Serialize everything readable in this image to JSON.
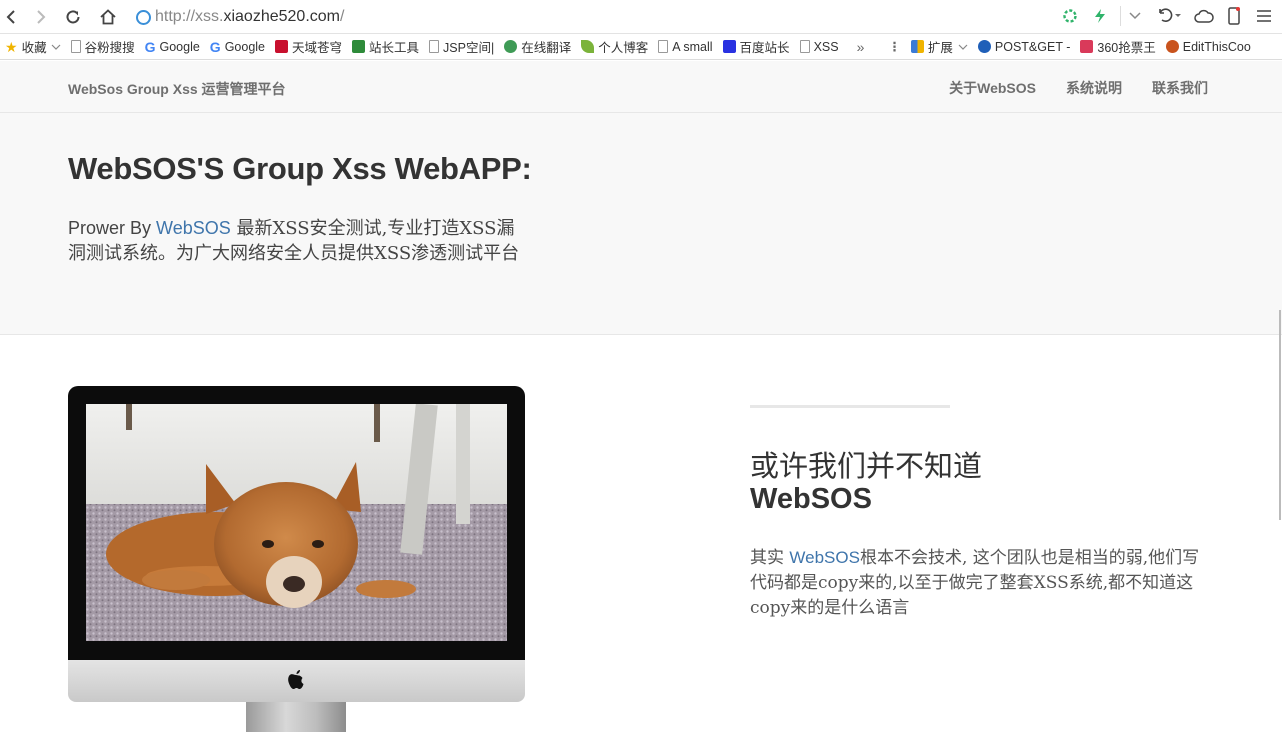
{
  "browser": {
    "url_prefix": "http://xss.",
    "url_domain": "xiaozhe520.com",
    "url_suffix": "/",
    "bookmarks": [
      {
        "label": "收藏",
        "icon": "star-icon"
      },
      {
        "label": "谷粉搜搜",
        "icon": "page-icon"
      },
      {
        "label": "Google",
        "icon": "google-icon"
      },
      {
        "label": "Google",
        "icon": "google-icon"
      },
      {
        "label": "天域苍穹",
        "icon": "site-icon",
        "color": "#c8102e"
      },
      {
        "label": "站长工具",
        "icon": "site-icon",
        "color": "#2e8b3a"
      },
      {
        "label": "JSP空间|",
        "icon": "page-icon"
      },
      {
        "label": "在线翻译",
        "icon": "translate-icon",
        "color": "#3f9b56"
      },
      {
        "label": "个人博客",
        "icon": "leaf-icon",
        "color": "#7bb33a"
      },
      {
        "label": "A small",
        "icon": "page-icon"
      },
      {
        "label": "百度站长",
        "icon": "baidu-icon",
        "color": "#2932e1"
      },
      {
        "label": "XSS",
        "icon": "page-icon"
      }
    ],
    "more": "»",
    "extensions": [
      {
        "label": "扩展",
        "icon": "extension-icon",
        "color": "#3b7bd6"
      },
      {
        "label": "POST&GET -",
        "icon": "globe-icon",
        "color": "#1f5fb8"
      },
      {
        "label": "360抢票王",
        "icon": "ticket-icon",
        "color": "#d93a5a"
      },
      {
        "label": "EditThisCoo",
        "icon": "cookie-icon",
        "color": "#c9531d"
      }
    ]
  },
  "nav": {
    "brand": "WebSos Group Xss 运营管理平台",
    "links": [
      "关于WebSOS",
      "系统说明",
      "联系我们"
    ]
  },
  "hero": {
    "title": "WebSOS'S Group Xss WebAPP:",
    "text_prefix": "Prower By ",
    "text_link": "WebSOS",
    "text_rest": " 最新XSS安全测试,专业打造XSS漏洞测试系统。为广大网络安全人员提供XSS渗透测试平台"
  },
  "section": {
    "title_cn": "或许我们并不知道",
    "title_en": "WebSOS",
    "text_prefix": "其实 ",
    "text_link": "WebSOS",
    "text_rest": "根本不会技术, 这个团队也是相当的弱,他们写代码都是copy来的,以至于做完了整套XSS系统,都不知道这copy来的是什么语言"
  }
}
